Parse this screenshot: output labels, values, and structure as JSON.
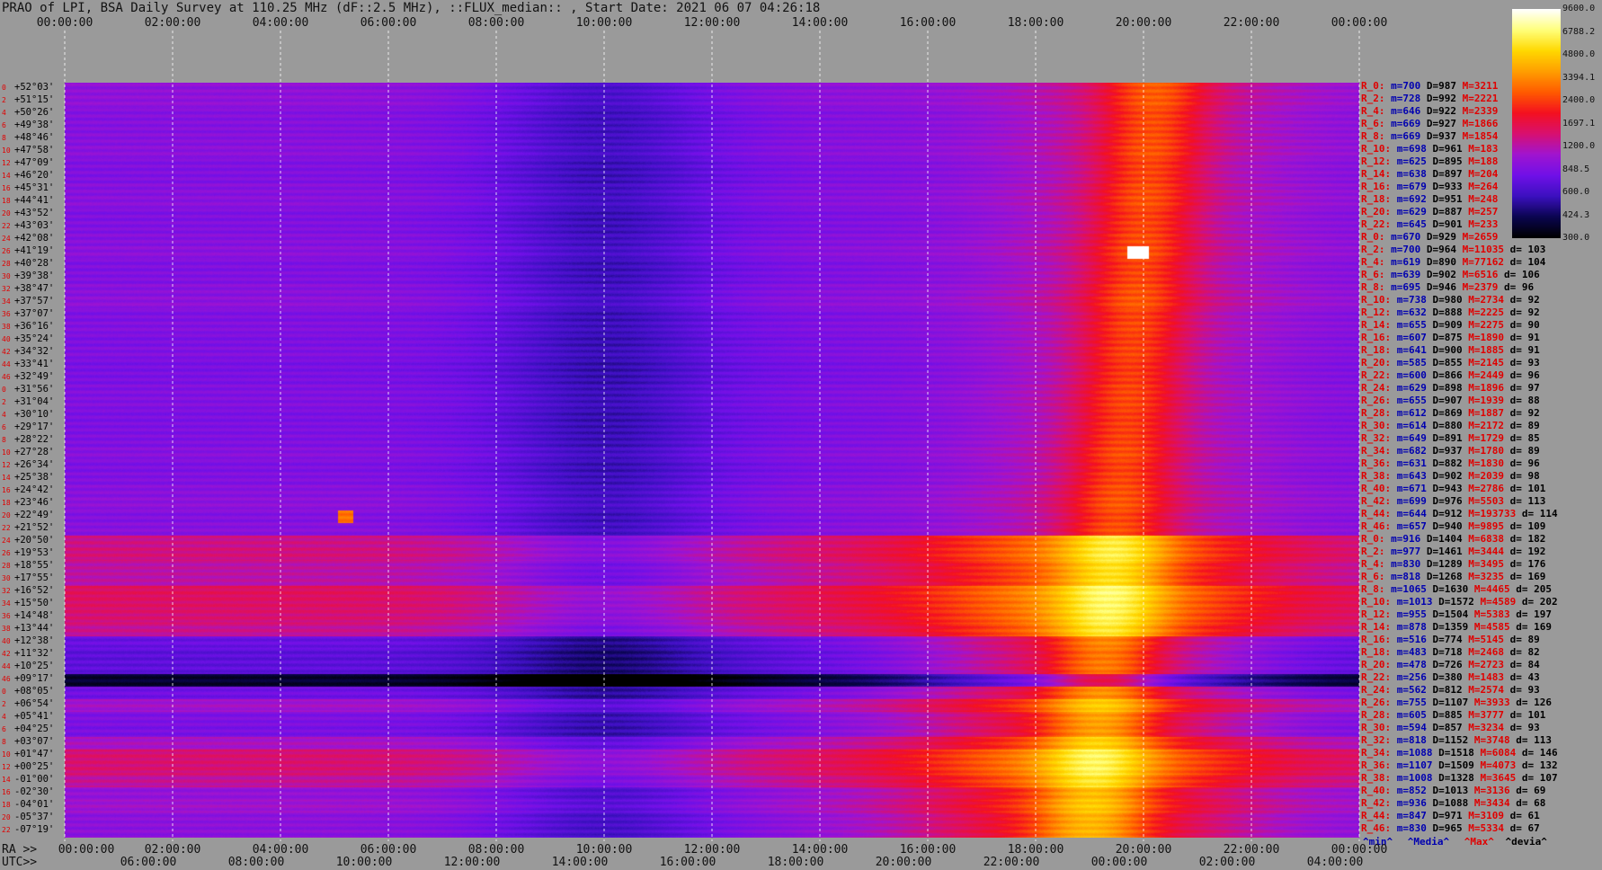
{
  "header": {
    "title": "PRAO of LPI, BSA Daily Survey at 110.25 MHz (dF::2.5 MHz), ::FLUX_median:: , Start Date: 2021 06 07 04:26:18"
  },
  "colors": {
    "background": "#9a9a9a",
    "colormap": [
      "#000000",
      "#0a0550",
      "#3c10c0",
      "#7010e8",
      "#a014d0",
      "#d81070",
      "#f41020",
      "#ff5a00",
      "#ff9e00",
      "#ffd800",
      "#ffff7a",
      "#ffffff"
    ],
    "index_label": "#e00000",
    "stat_blue": "#0000b0",
    "stat_red": "#e00000"
  },
  "chart_data": {
    "type": "heatmap",
    "title": "PRAO of LPI, BSA Daily Survey at 110.25 MHz (dF::2.5 MHz), ::FLUX_median:: , Start Date: 2021 06 07 04:26:18",
    "top_axis_ticks": [
      "00:00:00",
      "02:00:00",
      "04:00:00",
      "06:00:00",
      "08:00:00",
      "10:00:00",
      "12:00:00",
      "14:00:00",
      "16:00:00",
      "18:00:00",
      "20:00:00",
      "22:00:00",
      "00:00:00"
    ],
    "ra_axis": {
      "label": "RA >>",
      "ticks": [
        "00:00:00",
        "02:00:00",
        "04:00:00",
        "06:00:00",
        "08:00:00",
        "10:00:00",
        "12:00:00",
        "14:00:00",
        "16:00:00",
        "18:00:00",
        "20:00:00",
        "22:00:00",
        "00:00:00"
      ]
    },
    "utc_axis": {
      "label": "UTC>>",
      "ticks": [
        "06:00:00",
        "08:00:00",
        "10:00:00",
        "12:00:00",
        "14:00:00",
        "16:00:00",
        "18:00:00",
        "20:00:00",
        "22:00:00",
        "00:00:00",
        "02:00:00",
        "04:00:00"
      ]
    },
    "declinations": [
      "+52°03'",
      "+51°15'",
      "+50°26'",
      "+49°38'",
      "+48°46'",
      "+47°58'",
      "+47°09'",
      "+46°20'",
      "+45°31'",
      "+44°41'",
      "+43°52'",
      "+43°03'",
      "+42°08'",
      "+41°19'",
      "+40°28'",
      "+39°38'",
      "+38°47'",
      "+37°57'",
      "+37°07'",
      "+36°16'",
      "+35°24'",
      "+34°32'",
      "+33°41'",
      "+32°49'",
      "+31°56'",
      "+31°04'",
      "+30°10'",
      "+29°17'",
      "+28°22'",
      "+27°28'",
      "+26°34'",
      "+25°38'",
      "+24°42'",
      "+23°46'",
      "+22°49'",
      "+21°52'",
      "+20°50'",
      "+19°53'",
      "+18°55'",
      "+17°55'",
      "+16°52'",
      "+15°50'",
      "+14°48'",
      "+13°44'",
      "+12°38'",
      "+11°32'",
      "+10°25'",
      "+09°17'",
      "+08°05'",
      "+06°54'",
      "+05°41'",
      "+04°25'",
      "+03°07'",
      "+01°47'",
      "+00°25'",
      "-01°00'",
      "-02°30'",
      "-04°01'",
      "-05°37'",
      "-07°19'"
    ],
    "colorbar": {
      "min": 300.0,
      "max": 9600.0,
      "ticks": [
        "9600.0",
        "6788.2",
        "4800.0",
        "3394.1",
        "2400.0",
        "1697.1",
        "1200.0",
        "848.5",
        "600.0",
        "424.3",
        "300.0"
      ]
    },
    "row_stats": [
      {
        "r": "R_0:",
        "min": "700",
        "med": "987",
        "max": "3211",
        "dev": ""
      },
      {
        "r": "R_2:",
        "min": "728",
        "med": "992",
        "max": "2221",
        "dev": ""
      },
      {
        "r": "R_4:",
        "min": "646",
        "med": "922",
        "max": "2339",
        "dev": ""
      },
      {
        "r": "R_6:",
        "min": "669",
        "med": "927",
        "max": "1866",
        "dev": ""
      },
      {
        "r": "R_8:",
        "min": "669",
        "med": "937",
        "max": "1854",
        "dev": ""
      },
      {
        "r": "R_10:",
        "min": "698",
        "med": "961",
        "max": "183",
        "dev": ""
      },
      {
        "r": "R_12:",
        "min": "625",
        "med": "895",
        "max": "188",
        "dev": ""
      },
      {
        "r": "R_14:",
        "min": "638",
        "med": "897",
        "max": "204",
        "dev": ""
      },
      {
        "r": "R_16:",
        "min": "679",
        "med": "933",
        "max": "264",
        "dev": ""
      },
      {
        "r": "R_18:",
        "min": "692",
        "med": "951",
        "max": "248",
        "dev": ""
      },
      {
        "r": "R_20:",
        "min": "629",
        "med": "887",
        "max": "257",
        "dev": ""
      },
      {
        "r": "R_22:",
        "min": "645",
        "med": "901",
        "max": "233",
        "dev": ""
      },
      {
        "r": "R_0:",
        "min": "670",
        "med": "929",
        "max": "2659",
        "dev": ""
      },
      {
        "r": "R_2:",
        "min": "700",
        "med": "964",
        "max": "11035",
        "dev": "103"
      },
      {
        "r": "R_4:",
        "min": "619",
        "med": "890",
        "max": "77162",
        "dev": "104"
      },
      {
        "r": "R_6:",
        "min": "639",
        "med": "902",
        "max": "6516",
        "dev": "106"
      },
      {
        "r": "R_8:",
        "min": "695",
        "med": "946",
        "max": "2379",
        "dev": "96"
      },
      {
        "r": "R_10:",
        "min": "738",
        "med": "980",
        "max": "2734",
        "dev": "92"
      },
      {
        "r": "R_12:",
        "min": "632",
        "med": "888",
        "max": "2225",
        "dev": "92"
      },
      {
        "r": "R_14:",
        "min": "655",
        "med": "909",
        "max": "2275",
        "dev": "90"
      },
      {
        "r": "R_16:",
        "min": "607",
        "med": "875",
        "max": "1890",
        "dev": "91"
      },
      {
        "r": "R_18:",
        "min": "641",
        "med": "900",
        "max": "1885",
        "dev": "91"
      },
      {
        "r": "R_20:",
        "min": "585",
        "med": "855",
        "max": "2145",
        "dev": "93"
      },
      {
        "r": "R_22:",
        "min": "600",
        "med": "866",
        "max": "2449",
        "dev": "96"
      },
      {
        "r": "R_24:",
        "min": "629",
        "med": "898",
        "max": "1896",
        "dev": "97"
      },
      {
        "r": "R_26:",
        "min": "655",
        "med": "907",
        "max": "1939",
        "dev": "88"
      },
      {
        "r": "R_28:",
        "min": "612",
        "med": "869",
        "max": "1887",
        "dev": "92"
      },
      {
        "r": "R_30:",
        "min": "614",
        "med": "880",
        "max": "2172",
        "dev": "89"
      },
      {
        "r": "R_32:",
        "min": "649",
        "med": "891",
        "max": "1729",
        "dev": "85"
      },
      {
        "r": "R_34:",
        "min": "682",
        "med": "937",
        "max": "1780",
        "dev": "89"
      },
      {
        "r": "R_36:",
        "min": "631",
        "med": "882",
        "max": "1830",
        "dev": "96"
      },
      {
        "r": "R_38:",
        "min": "643",
        "med": "902",
        "max": "2039",
        "dev": "98"
      },
      {
        "r": "R_40:",
        "min": "671",
        "med": "943",
        "max": "2786",
        "dev": "101"
      },
      {
        "r": "R_42:",
        "min": "699",
        "med": "976",
        "max": "5503",
        "dev": "113"
      },
      {
        "r": "R_44:",
        "min": "644",
        "med": "912",
        "max": "193733",
        "dev": "114"
      },
      {
        "r": "R_46:",
        "min": "657",
        "med": "940",
        "max": "9895",
        "dev": "109"
      },
      {
        "r": "R_0:",
        "min": "916",
        "med": "1404",
        "max": "6838",
        "dev": "182"
      },
      {
        "r": "R_2:",
        "min": "977",
        "med": "1461",
        "max": "3444",
        "dev": "192"
      },
      {
        "r": "R_4:",
        "min": "830",
        "med": "1289",
        "max": "3495",
        "dev": "176"
      },
      {
        "r": "R_6:",
        "min": "818",
        "med": "1268",
        "max": "3235",
        "dev": "169"
      },
      {
        "r": "R_8:",
        "min": "1065",
        "med": "1630",
        "max": "4465",
        "dev": "205"
      },
      {
        "r": "R_10:",
        "min": "1013",
        "med": "1572",
        "max": "4589",
        "dev": "202"
      },
      {
        "r": "R_12:",
        "min": "955",
        "med": "1504",
        "max": "5383",
        "dev": "197"
      },
      {
        "r": "R_14:",
        "min": "878",
        "med": "1359",
        "max": "4585",
        "dev": "169"
      },
      {
        "r": "R_16:",
        "min": "516",
        "med": "774",
        "max": "5145",
        "dev": "89"
      },
      {
        "r": "R_18:",
        "min": "483",
        "med": "718",
        "max": "2468",
        "dev": "82"
      },
      {
        "r": "R_20:",
        "min": "478",
        "med": "726",
        "max": "2723",
        "dev": "84"
      },
      {
        "r": "R_22:",
        "min": "256",
        "med": "380",
        "max": "1483",
        "dev": "43"
      },
      {
        "r": "R_24:",
        "min": "562",
        "med": "812",
        "max": "2574",
        "dev": "93"
      },
      {
        "r": "R_26:",
        "min": "755",
        "med": "1107",
        "max": "3933",
        "dev": "126"
      },
      {
        "r": "R_28:",
        "min": "605",
        "med": "885",
        "max": "3777",
        "dev": "101"
      },
      {
        "r": "R_30:",
        "min": "594",
        "med": "857",
        "max": "3234",
        "dev": "93"
      },
      {
        "r": "R_32:",
        "min": "818",
        "med": "1152",
        "max": "3748",
        "dev": "113"
      },
      {
        "r": "R_34:",
        "min": "1088",
        "med": "1518",
        "max": "6084",
        "dev": "146"
      },
      {
        "r": "R_36:",
        "min": "1107",
        "med": "1509",
        "max": "4073",
        "dev": "132"
      },
      {
        "r": "R_38:",
        "min": "1008",
        "med": "1328",
        "max": "3645",
        "dev": "107"
      },
      {
        "r": "R_40:",
        "min": "852",
        "med": "1013",
        "max": "3136",
        "dev": "69"
      },
      {
        "r": "R_42:",
        "min": "936",
        "med": "1088",
        "max": "3434",
        "dev": "68"
      },
      {
        "r": "R_44:",
        "min": "847",
        "med": "971",
        "max": "3109",
        "dev": "61"
      },
      {
        "r": "R_46:",
        "min": "830",
        "med": "965",
        "max": "5334",
        "dev": "67"
      }
    ],
    "stat_legend": {
      "min": "^min^",
      "med": "^Media^",
      "max": "^Max^",
      "dev": "^devia^"
    },
    "grid": "vertical dashed lines every 2 h",
    "legend_placement": "right"
  }
}
